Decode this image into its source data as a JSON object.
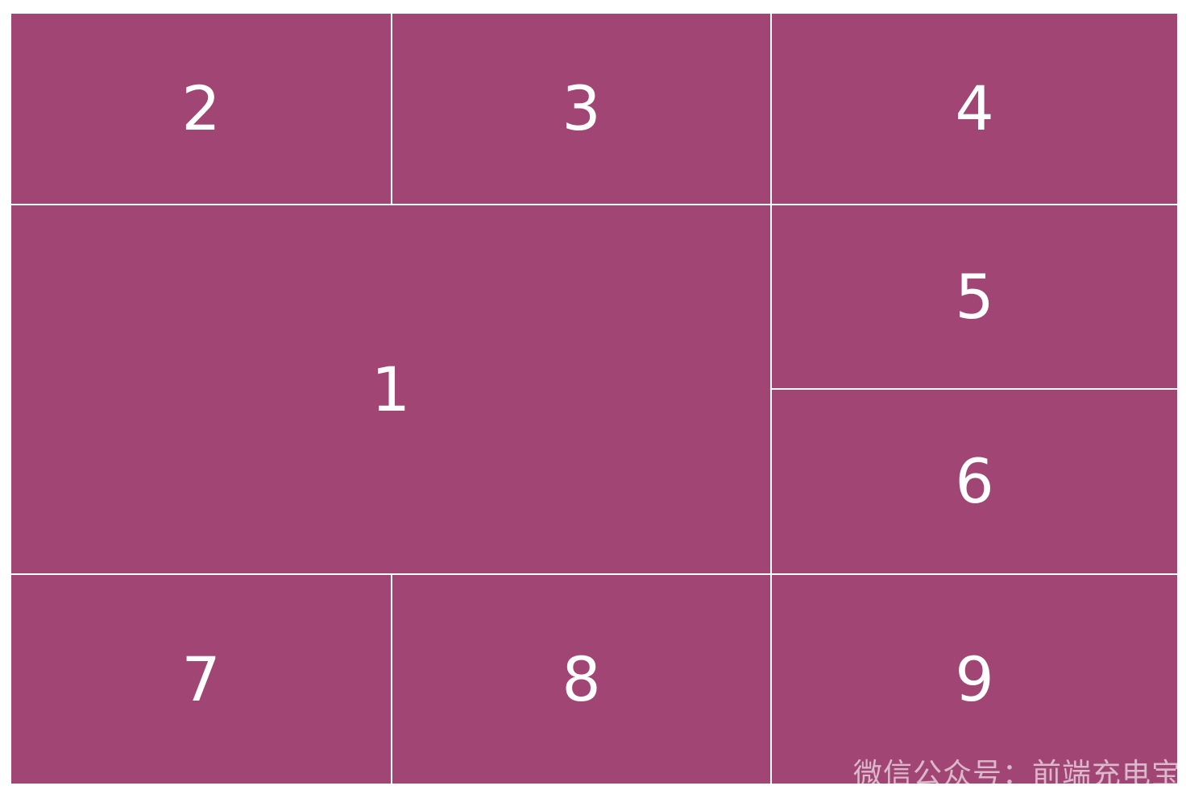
{
  "cells": {
    "c1": "1",
    "c2": "2",
    "c3": "3",
    "c4": "4",
    "c5": "5",
    "c6": "6",
    "c7": "7",
    "c8": "8",
    "c9": "9"
  },
  "watermark": "微信公众号：前端充电宝",
  "colors": {
    "cell_background": "#a14674",
    "gap": "#ffffff",
    "text": "#ffffff"
  }
}
